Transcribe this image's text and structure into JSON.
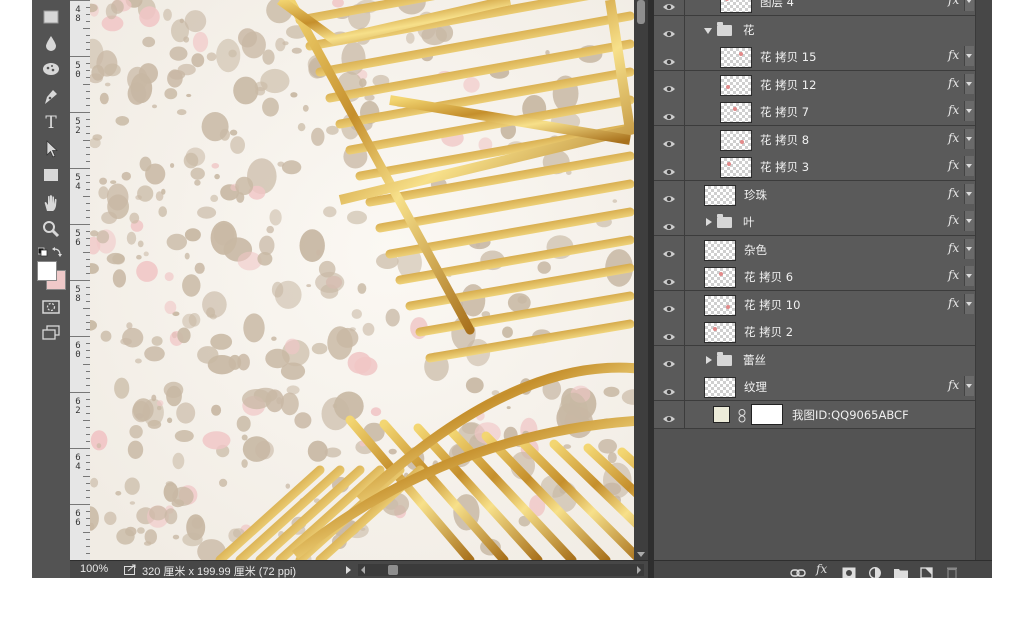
{
  "app": {
    "colors": {
      "panel": "#535353",
      "dark": "#3c3c3c",
      "gold": "#c8952e",
      "lace": "#c9b8a3",
      "cream": "#ece3d7"
    }
  },
  "tools": [
    {
      "name": "marquee-tool",
      "icon": "rectangle-marquee-icon"
    },
    {
      "name": "blur-tool",
      "icon": "drop-icon"
    },
    {
      "name": "dodge-tool",
      "icon": "sponge-icon"
    },
    {
      "name": "pen-tool",
      "icon": "pen-icon"
    },
    {
      "name": "type-tool",
      "icon": "type-icon",
      "label": "T"
    },
    {
      "name": "path-selection-tool",
      "icon": "arrow-cursor-icon"
    },
    {
      "name": "shape-tool",
      "icon": "rectangle-shape-icon"
    },
    {
      "name": "hand-tool",
      "icon": "hand-icon"
    },
    {
      "name": "zoom-tool",
      "icon": "magnifier-icon"
    }
  ],
  "ruler": {
    "labels": [
      "48",
      "50",
      "52",
      "54",
      "56",
      "58",
      "60",
      "62",
      "64",
      "66"
    ]
  },
  "status": {
    "zoom": "100%",
    "doc_info": "320 厘米 x 199.99 厘米 (72 ppi)"
  },
  "layers": [
    {
      "name": "图层 4",
      "kind": "layer",
      "indent": 1,
      "fx": true
    },
    {
      "name": "花",
      "kind": "group-open",
      "indent": 0,
      "fx": false
    },
    {
      "name": "花 拷贝 15",
      "kind": "layer",
      "indent": 1,
      "fx": true
    },
    {
      "name": "花 拷贝 12",
      "kind": "layer",
      "indent": 1,
      "fx": true
    },
    {
      "name": "花 拷贝 7",
      "kind": "layer",
      "indent": 1,
      "fx": true
    },
    {
      "name": "花 拷贝 8",
      "kind": "layer",
      "indent": 1,
      "fx": true
    },
    {
      "name": "花 拷贝 3",
      "kind": "layer",
      "indent": 1,
      "fx": true
    },
    {
      "name": "珍珠",
      "kind": "layer",
      "indent": 0,
      "fx": true
    },
    {
      "name": "叶",
      "kind": "group-closed",
      "indent": 0,
      "fx": true
    },
    {
      "name": "杂色",
      "kind": "layer",
      "indent": 0,
      "fx": true
    },
    {
      "name": "花 拷贝 6",
      "kind": "layer",
      "indent": 0,
      "fx": true
    },
    {
      "name": "花 拷贝 10",
      "kind": "layer",
      "indent": 0,
      "fx": true
    },
    {
      "name": "花 拷贝 2",
      "kind": "layer",
      "indent": 0,
      "fx": false
    },
    {
      "name": "蕾丝",
      "kind": "group-closed",
      "indent": 0,
      "fx": false
    },
    {
      "name": "纹理",
      "kind": "layer",
      "indent": 0,
      "fx": true
    },
    {
      "name": "我图ID:QQ9065ABCF",
      "kind": "fill-layer",
      "indent": 0,
      "fx": false
    }
  ],
  "layer_fx_label": "fx",
  "panel_footer": [
    "link-layers-icon",
    "fx-icon",
    "layer-mask-icon",
    "adjustment-layer-icon",
    "new-group-icon",
    "new-layer-icon",
    "trash-icon"
  ]
}
